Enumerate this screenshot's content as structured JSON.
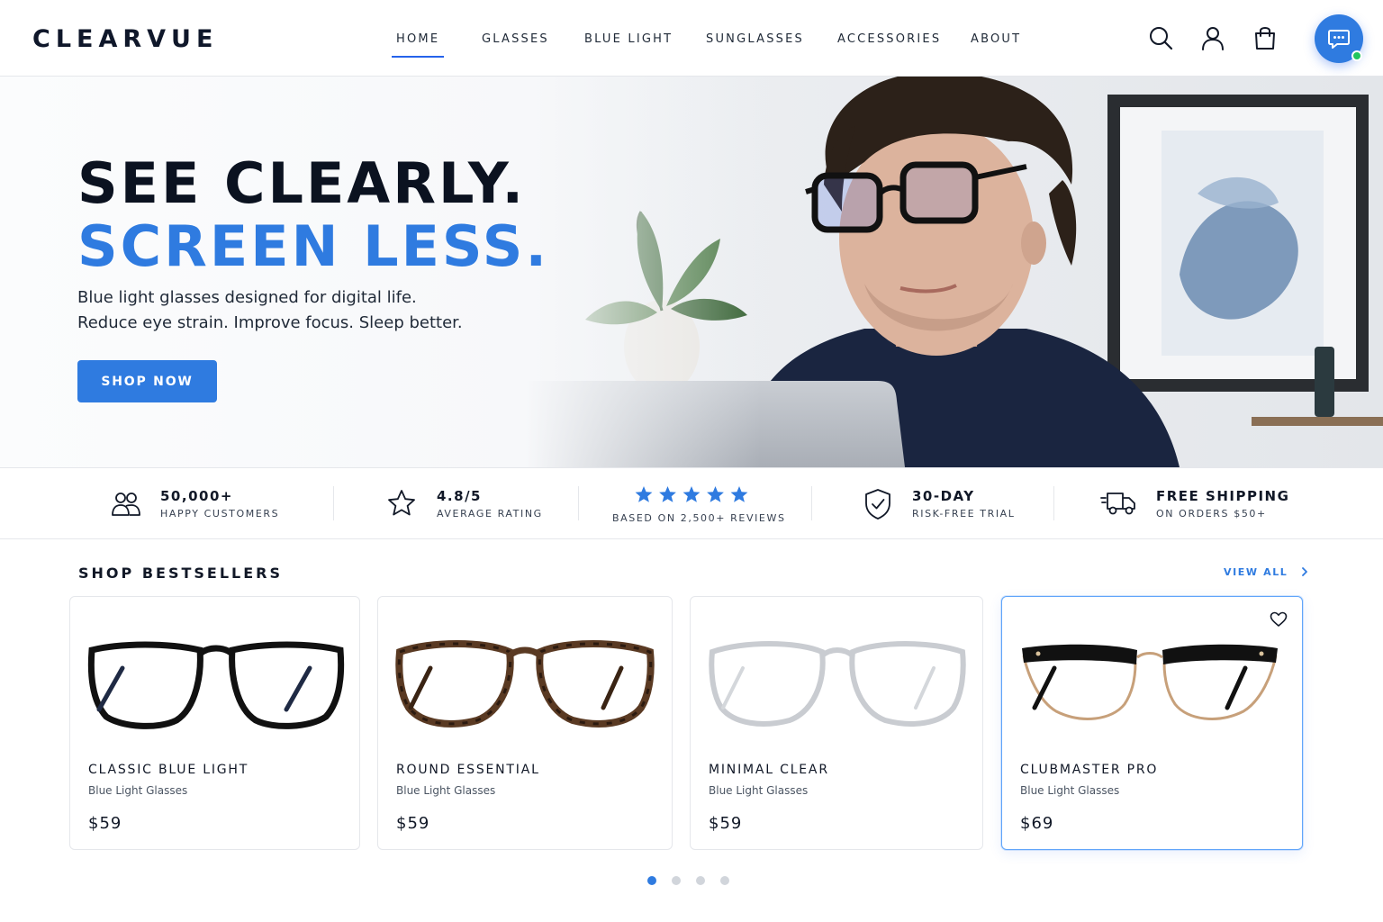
{
  "brand": {
    "logo": "CLEARVUE"
  },
  "nav": {
    "items": [
      {
        "label": "HOME",
        "active": true
      },
      {
        "label": "GLASSES",
        "active": false
      },
      {
        "label": "BLUE LIGHT",
        "active": false
      },
      {
        "label": "SUNGLASSES",
        "active": false
      },
      {
        "label": "ACCESSORIES",
        "active": false
      },
      {
        "label": "ABOUT",
        "active": false
      }
    ],
    "icons": [
      "search-icon",
      "user-icon",
      "shopping-bag-icon",
      "chat-icon"
    ]
  },
  "hero": {
    "title_line1": "SEE CLEARLY.",
    "title_line2": "SCREEN LESS.",
    "subtitle_line1": "Blue light glasses designed for digital life.",
    "subtitle_line2": "Reduce eye strain. Improve focus. Sleep better.",
    "cta": "SHOP NOW"
  },
  "stats": [
    {
      "icon": "users-icon",
      "value": "50,000+",
      "label": "HAPPY CUSTOMERS"
    },
    {
      "icon": "star-outline-icon",
      "value": "4.8/5",
      "label": "AVERAGE RATING"
    },
    {
      "icon": "five-stars-icon",
      "value": "",
      "label": "BASED ON 2,500+ REVIEWS"
    },
    {
      "icon": "shield-check-icon",
      "value": "30-DAY",
      "label": "RISK-FREE TRIAL"
    },
    {
      "icon": "truck-icon",
      "value": "FREE SHIPPING",
      "label": "ON ORDERS $50+"
    }
  ],
  "bestsellers": {
    "title": "SHOP BESTSELLERS",
    "view_all": "VIEW ALL",
    "products": [
      {
        "name": "CLASSIC BLUE LIGHT",
        "category": "Blue Light Glasses",
        "price": "$59",
        "frame": "black"
      },
      {
        "name": "ROUND ESSENTIAL",
        "category": "Blue Light Glasses",
        "price": "$59",
        "frame": "tortoise"
      },
      {
        "name": "MINIMAL CLEAR",
        "category": "Blue Light Glasses",
        "price": "$59",
        "frame": "clear"
      },
      {
        "name": "CLUBMASTER PRO",
        "category": "Blue Light Glasses",
        "price": "$69",
        "frame": "browline"
      }
    ],
    "carousel": {
      "pages": 4,
      "current": 1
    }
  },
  "colors": {
    "accent": "#2f7be0",
    "text_dark": "#0b1220",
    "online": "#22c55e"
  }
}
